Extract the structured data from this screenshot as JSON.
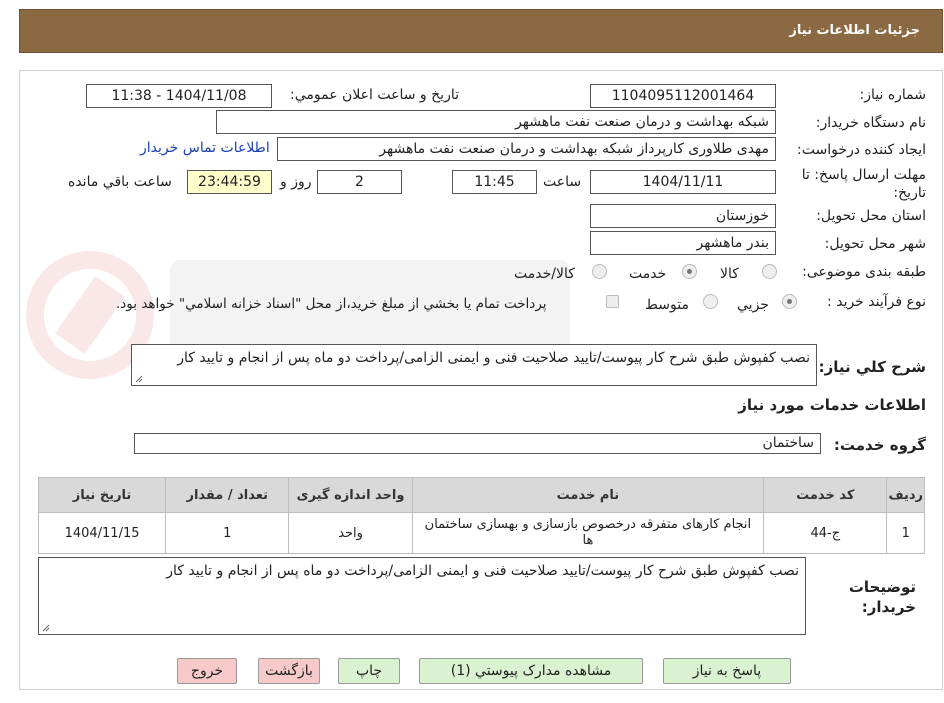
{
  "header": {
    "title": "جزئیات اطلاعات نیاز"
  },
  "fields": {
    "need_number": {
      "label": "شماره نیاز:",
      "value": "1104095112001464"
    },
    "announce_datetime": {
      "label": "تاریخ و ساعت اعلان عمومي:",
      "value": "1404/11/08 - 11:38"
    },
    "buyer_org": {
      "label": "نام دستگاه خريدار:",
      "value": "شبکه بهداشت و درمان صنعت نفت ماهشهر"
    },
    "requester": {
      "label": "ايجاد کننده درخواست:",
      "value": "مهدی طلاوری کارپرداز شبکه بهداشت و درمان صنعت نفت ماهشهر"
    },
    "buyer_contact_link": "اطلاعات تماس خريدار",
    "deadline": {
      "label": "مهلت ارسال پاسخ: تا تاریخ:",
      "date": "1404/11/11",
      "time_label": "ساعت",
      "time": "11:45",
      "days": "2",
      "days_label": "روز و",
      "remaining": "23:44:59",
      "remaining_label": "ساعت باقي مانده"
    },
    "delivery_province": {
      "label": "استان محل تحويل:",
      "value": "خوزستان"
    },
    "delivery_city": {
      "label": "شهر محل تحويل:",
      "value": "بندر ماهشهر"
    },
    "category": {
      "label": "طبقه بندی موضوعی:",
      "options": [
        "کالا",
        "خدمت",
        "کالا/خدمت"
      ],
      "selected": "خدمت"
    },
    "purchase_type": {
      "label": "نوع فرآيند خريد :",
      "options": [
        "جزيي",
        "متوسط"
      ],
      "selected": "جزيي",
      "note": "پرداخت تمام يا بخشي از مبلغ خريد،از محل \"اسناد خزانه اسلامي\" خواهد بود."
    },
    "general_description": {
      "label": "شرح کلي نياز:",
      "value": "نصب کفپوش طبق شرح کار پیوست/تایید صلاحیت فنی و ایمنی الزامی/پرداخت دو ماه پس از انجام و تایید کار"
    }
  },
  "services": {
    "section_title": "اطلاعات خدمات مورد نياز",
    "group_label": "گروه خدمت:",
    "group_value": "ساختمان",
    "columns": [
      "رديف",
      "کد خدمت",
      "نام خدمت",
      "واحد اندازه گيری",
      "تعداد / مقدار",
      "تاريخ نياز"
    ],
    "rows": [
      {
        "row": "1",
        "code": "ج-44",
        "name": "انجام کارهای متفرقه درخصوص بازسازی و بهسازی ساختمان ها",
        "unit": "واحد",
        "qty": "1",
        "date": "1404/11/15"
      }
    ]
  },
  "buyer_notes": {
    "label": "توضيحات خريدار:",
    "value": "نصب کفپوش طبق شرح کار پیوست/تایید صلاحیت فنی و ایمنی الزامی/پرداخت دو ماه پس از انجام و تایید کار"
  },
  "buttons": {
    "reply": "پاسخ به نياز",
    "attachments": "مشاهده مدارک پيوستي (1)",
    "print": "چاپ",
    "back": "بازگشت",
    "exit": "خروج"
  },
  "colors": {
    "header_bg": "#8b6a43",
    "green_button": "#d9f2d0",
    "pink_button": "#f7c9c9",
    "remaining_bg": "#ffffcc"
  }
}
